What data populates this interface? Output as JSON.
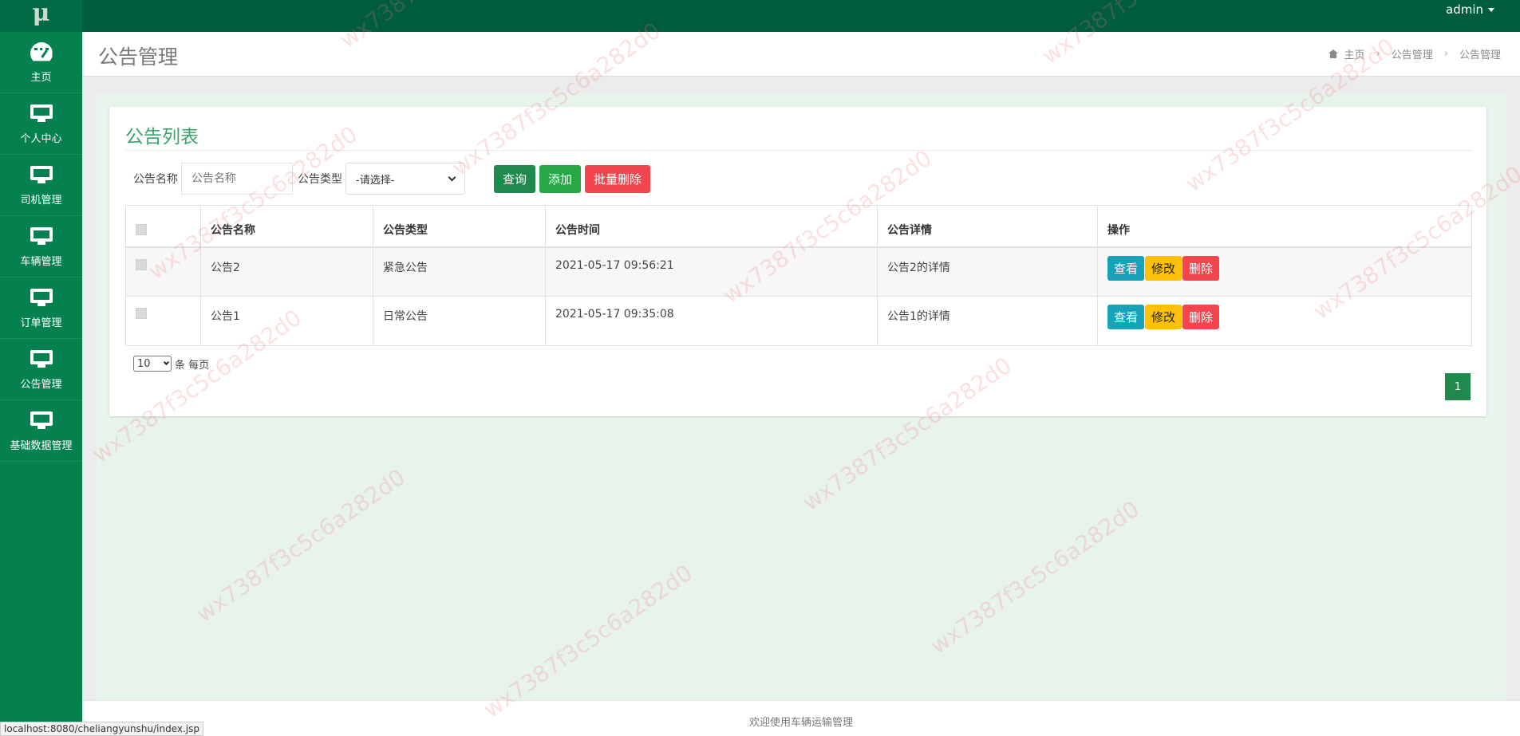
{
  "app": {
    "logo": "μ",
    "user": "admin"
  },
  "sidebar": {
    "items": [
      {
        "label": "主页",
        "icon": "dashboard-icon"
      },
      {
        "label": "个人中心",
        "icon": "monitor-icon"
      },
      {
        "label": "司机管理",
        "icon": "monitor-icon"
      },
      {
        "label": "车辆管理",
        "icon": "monitor-icon"
      },
      {
        "label": "订单管理",
        "icon": "monitor-icon"
      },
      {
        "label": "公告管理",
        "icon": "monitor-icon"
      },
      {
        "label": "基础数据管理",
        "icon": "monitor-icon"
      }
    ]
  },
  "header": {
    "title": "公告管理",
    "breadcrumb": [
      "主页",
      "公告管理",
      "公告管理"
    ]
  },
  "card": {
    "title": "公告列表"
  },
  "search": {
    "name_label": "公告名称",
    "name_placeholder": "公告名称",
    "type_label": "公告类型",
    "type_selected": "-请选择-",
    "query_button": "查询",
    "add_button": "添加",
    "batch_delete_button": "批量删除"
  },
  "table": {
    "columns": [
      "公告名称",
      "公告类型",
      "公告时间",
      "公告详情",
      "操作"
    ],
    "rows": [
      {
        "name": "公告2",
        "type": "紧急公告",
        "time": "2021-05-17 09:56:21",
        "detail": "公告2的详情"
      },
      {
        "name": "公告1",
        "type": "日常公告",
        "time": "2021-05-17 09:35:08",
        "detail": "公告1的详情"
      }
    ],
    "actions": {
      "view": "查看",
      "edit": "修改",
      "delete": "删除"
    }
  },
  "pagination": {
    "page_size": "10",
    "per_page_text": "条 每页",
    "current_page": "1"
  },
  "footer": {
    "text": "欢迎使用车辆运输管理"
  },
  "status_bar": {
    "url": "localhost:8080/cheliangyunshu/index.jsp"
  },
  "watermark": "wx7387f3c5c6a282d0",
  "colors": {
    "topbar": "#005c3f",
    "sidebar": "#04814e",
    "accent": "#3aa46b",
    "query": "#20894d",
    "add": "#28a745",
    "danger": "#f3454e",
    "info": "#17a2b8",
    "warning": "#ffc107"
  }
}
